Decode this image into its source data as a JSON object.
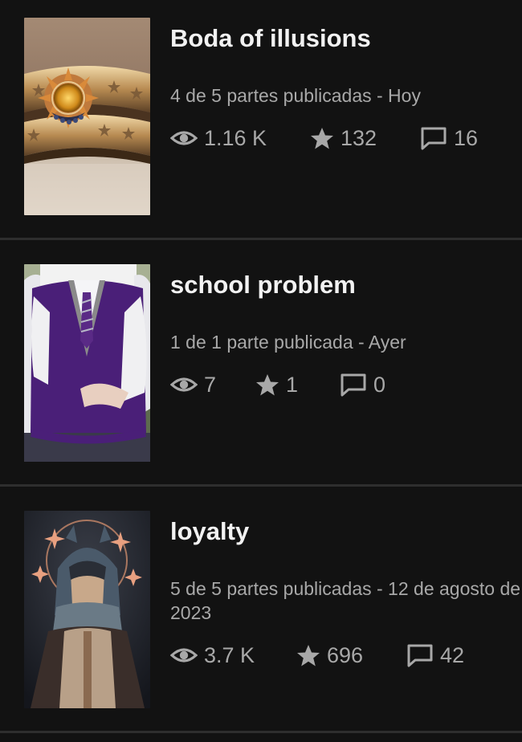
{
  "stories": [
    {
      "title": "Boda of illusions",
      "meta": "4 de 5 partes publicadas - Hoy",
      "icons": [
        "eye-icon",
        "star-icon",
        "comment-icon"
      ],
      "reads": "1.16 K",
      "votes": "132",
      "comments": "16"
    },
    {
      "title": "school problem",
      "meta": "1 de 1 parte publicada - Ayer",
      "reads": "7",
      "votes": "1",
      "comments": "0"
    },
    {
      "title": "loyalty",
      "meta": "5 de 5 partes publicadas - 12 de agosto de 2023",
      "reads": "3.7 K",
      "votes": "696",
      "comments": "42"
    }
  ]
}
